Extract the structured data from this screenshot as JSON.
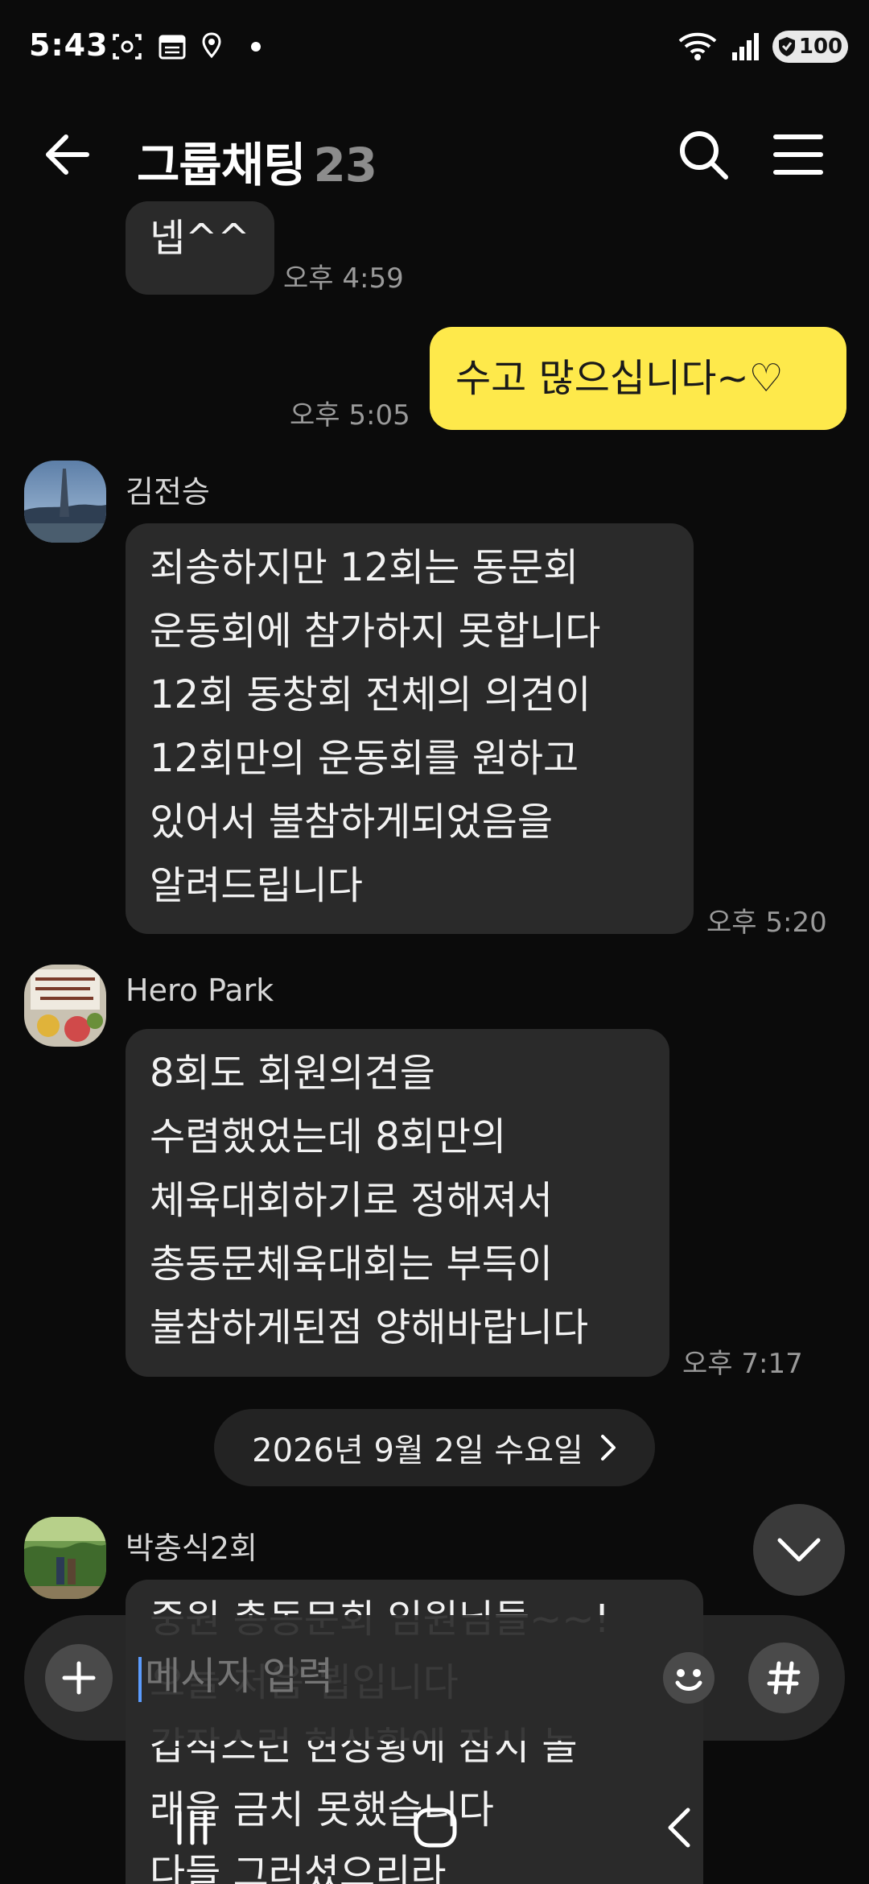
{
  "status_bar": {
    "time": "5:43",
    "battery": "100",
    "left_icons": [
      "screenshot-icon",
      "calendar-icon",
      "location-icon",
      "notification-dot-icon"
    ],
    "right_icons": [
      "wifi-icon",
      "signal-icon",
      "battery-icon"
    ]
  },
  "header": {
    "title": "그룹채팅",
    "member_count": "23",
    "icons": [
      "back-arrow-icon",
      "search-icon",
      "hamburger-menu-icon"
    ]
  },
  "messages": [
    {
      "type": "incoming",
      "text": "넵^^",
      "time": "오후 4:59"
    },
    {
      "type": "outgoing",
      "text": "수고 많으십니다~♡",
      "time": "오후 5:05"
    },
    {
      "type": "incoming",
      "sender": "김전승",
      "text": "죄송하지만 12회는 동문회\n운동회에 참가하지 못합니다\n12회 동창회 전체의 의견이\n12회만의 운동회를 원하고\n있어서 불참하게되었음을\n알려드립니다",
      "time": "오후 5:20"
    },
    {
      "type": "incoming",
      "sender": "Hero Park",
      "text": "8회도 회원의견을\n수렴했었는데 8회만의\n체육대회하기로 정해져서\n총동문체육대회는 부득이\n불참하게된점 양해바랍니다",
      "time": "오후 7:17"
    },
    {
      "type": "incoming",
      "sender": "박충식2회",
      "text": "중원 총동문회 임원님들~~!\n오늘 처음 뵙입니다\n갑작스런 현상황에 잠시 놀\n래을 금치 못했습니다\n다들 그러셨으리라"
    }
  ],
  "date_divider": "2026년 9월 2일 수요일",
  "input": {
    "placeholder": "메시지 입력"
  },
  "colors": {
    "background": "#0b0b0b",
    "bubble_incoming": "#2a2a2a",
    "bubble_outgoing": "#fee94b"
  }
}
